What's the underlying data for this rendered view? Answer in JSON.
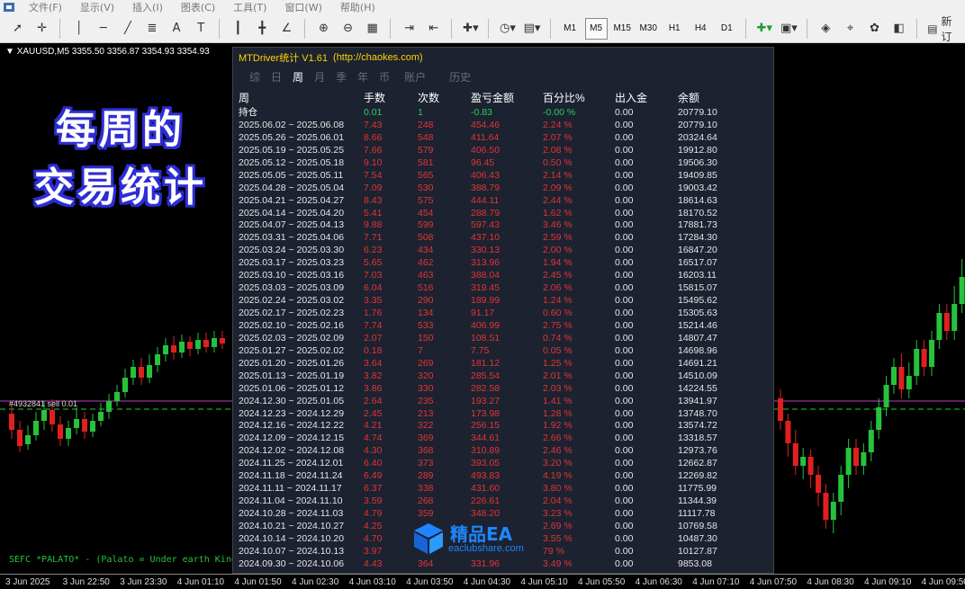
{
  "menu": [
    "文件(F)",
    "显示(V)",
    "插入(I)",
    "图表(C)",
    "工具(T)",
    "窗口(W)",
    "帮助(H)"
  ],
  "toolbar": {
    "timeframes": [
      "M1",
      "M5",
      "M15",
      "M30",
      "H1",
      "H4",
      "D1"
    ],
    "active_timeframe": "M5",
    "new_order_label": "新订"
  },
  "chart": {
    "symbol_line": "XAUUSD,M5  3355.50 3356.87 3354.93 3354.93",
    "order_label": "#4932841   sell 0.01",
    "ticker": "SEFC *PALATO* - (Palato = Under earth King",
    "x_labels": [
      "3 Jun 2025",
      "3 Jun 22:50",
      "3 Jun 23:30",
      "4 Jun 01:10",
      "4 Jun 01:50",
      "4 Jun 02:30",
      "4 Jun 03:10",
      "4 Jun 03:50",
      "4 Jun 04:30",
      "4 Jun 05:10",
      "4 Jun 05:50",
      "4 Jun 06:30",
      "4 Jun 07:10",
      "4 Jun 07:50",
      "4 Jun 08:30",
      "4 Jun 09:10",
      "4 Jun 09:50"
    ]
  },
  "overlay": {
    "line1": "每周的",
    "line2": "交易统计"
  },
  "panel": {
    "title": "MTDriver统计 V1.61",
    "url": "(http://chaokes.com)",
    "tabs": [
      "综",
      "日",
      "周",
      "月",
      "季",
      "年",
      "币",
      "账户",
      "历史"
    ],
    "active_tab": "周",
    "headers": [
      "周",
      "手数",
      "次数",
      "盈亏金额",
      "百分比%",
      "出入金",
      "余额"
    ],
    "holding": [
      "持仓",
      "0.01",
      "1",
      "-0.83",
      "-0.00 %",
      "0.00",
      "20779.10"
    ],
    "rows": [
      [
        "2025.06.02 ~ 2025.06.08",
        "7.43",
        "248",
        "454.46",
        "2.24 %",
        "0.00",
        "20779.10"
      ],
      [
        "2025.05.26 ~ 2025.06.01",
        "8.66",
        "548",
        "411.64",
        "2.07 %",
        "0.00",
        "20324.64"
      ],
      [
        "2025.05.19 ~ 2025.05.25",
        "7.66",
        "579",
        "406.50",
        "2.08 %",
        "0.00",
        "19912.80"
      ],
      [
        "2025.05.12 ~ 2025.05.18",
        "9.10",
        "581",
        "96.45",
        "0.50 %",
        "0.00",
        "19506.30"
      ],
      [
        "2025.05.05 ~ 2025.05.11",
        "7.54",
        "565",
        "406.43",
        "2.14 %",
        "0.00",
        "19409.85"
      ],
      [
        "2025.04.28 ~ 2025.05.04",
        "7.09",
        "530",
        "388.79",
        "2.09 %",
        "0.00",
        "19003.42"
      ],
      [
        "2025.04.21 ~ 2025.04.27",
        "8.43",
        "575",
        "444.11",
        "2.44 %",
        "0.00",
        "18614.63"
      ],
      [
        "2025.04.14 ~ 2025.04.20",
        "5.41",
        "454",
        "288.79",
        "1.62 %",
        "0.00",
        "18170.52"
      ],
      [
        "2025.04.07 ~ 2025.04.13",
        "9.88",
        "599",
        "597.43",
        "3.46 %",
        "0.00",
        "17881.73"
      ],
      [
        "2025.03.31 ~ 2025.04.06",
        "7.71",
        "508",
        "437.10",
        "2.59 %",
        "0.00",
        "17284.30"
      ],
      [
        "2025.03.24 ~ 2025.03.30",
        "6.23",
        "434",
        "330.13",
        "2.00 %",
        "0.00",
        "16847.20"
      ],
      [
        "2025.03.17 ~ 2025.03.23",
        "5.65",
        "462",
        "313.96",
        "1.94 %",
        "0.00",
        "16517.07"
      ],
      [
        "2025.03.10 ~ 2025.03.16",
        "7.03",
        "463",
        "388.04",
        "2.45 %",
        "0.00",
        "16203.11"
      ],
      [
        "2025.03.03 ~ 2025.03.09",
        "6.04",
        "516",
        "319.45",
        "2.06 %",
        "0.00",
        "15815.07"
      ],
      [
        "2025.02.24 ~ 2025.03.02",
        "3.35",
        "290",
        "189.99",
        "1.24 %",
        "0.00",
        "15495.62"
      ],
      [
        "2025.02.17 ~ 2025.02.23",
        "1.76",
        "134",
        "91.17",
        "0.60 %",
        "0.00",
        "15305.63"
      ],
      [
        "2025.02.10 ~ 2025.02.16",
        "7.74",
        "533",
        "406.99",
        "2.75 %",
        "0.00",
        "15214.46"
      ],
      [
        "2025.02.03 ~ 2025.02.09",
        "2.07",
        "150",
        "108.51",
        "0.74 %",
        "0.00",
        "14807.47"
      ],
      [
        "2025.01.27 ~ 2025.02.02",
        "0.18",
        "7",
        "7.75",
        "0.05 %",
        "0.00",
        "14698.96"
      ],
      [
        "2025.01.20 ~ 2025.01.26",
        "3.64",
        "269",
        "181.12",
        "1.25 %",
        "0.00",
        "14691.21"
      ],
      [
        "2025.01.13 ~ 2025.01.19",
        "3.82",
        "320",
        "285.54",
        "2.01 %",
        "0.00",
        "14510.09"
      ],
      [
        "2025.01.06 ~ 2025.01.12",
        "3.86",
        "330",
        "282.58",
        "2.03 %",
        "0.00",
        "14224.55"
      ],
      [
        "2024.12.30 ~ 2025.01.05",
        "2.64",
        "235",
        "193.27",
        "1.41 %",
        "0.00",
        "13941.97"
      ],
      [
        "2024.12.23 ~ 2024.12.29",
        "2.45",
        "213",
        "173.98",
        "1.28 %",
        "0.00",
        "13748.70"
      ],
      [
        "2024.12.16 ~ 2024.12.22",
        "4.21",
        "322",
        "256.15",
        "1.92 %",
        "0.00",
        "13574.72"
      ],
      [
        "2024.12.09 ~ 2024.12.15",
        "4.74",
        "369",
        "344.61",
        "2.66 %",
        "0.00",
        "13318.57"
      ],
      [
        "2024.12.02 ~ 2024.12.08",
        "4.30",
        "368",
        "310.89",
        "2.46 %",
        "0.00",
        "12973.76"
      ],
      [
        "2024.11.25 ~ 2024.12.01",
        "6.40",
        "373",
        "393.05",
        "3.20 %",
        "0.00",
        "12662.87"
      ],
      [
        "2024.11.18 ~ 2024.11.24",
        "6.49",
        "289",
        "493.83",
        "4.19 %",
        "0.00",
        "12269.82"
      ],
      [
        "2024.11.11 ~ 2024.11.17",
        "6.37",
        "338",
        "431.60",
        "3.80 %",
        "0.00",
        "11775.99"
      ],
      [
        "2024.11.04 ~ 2024.11.10",
        "3.59",
        "268",
        "226.61",
        "2.04 %",
        "0.00",
        "11344.39"
      ],
      [
        "2024.10.28 ~ 2024.11.03",
        "4.79",
        "359",
        "348.20",
        "3.23 %",
        "0.00",
        "11117.78"
      ],
      [
        "2024.10.21 ~ 2024.10.27",
        "4.25",
        "",
        "",
        "2.69 %",
        "0.00",
        "10769.58"
      ],
      [
        "2024.10.14 ~ 2024.10.20",
        "4.70",
        "",
        "",
        "3.55 %",
        "0.00",
        "10487.30"
      ],
      [
        "2024.10.07 ~ 2024.10.13",
        "3.97",
        "",
        "",
        "79 %",
        "0.00",
        "10127.87"
      ],
      [
        "2024.09.30 ~ 2024.10.06",
        "4.43",
        "364",
        "331.96",
        "3.49 %",
        "0.00",
        "9853.08"
      ]
    ]
  },
  "watermark": {
    "title": "精品EA",
    "url": "eaclubshare.com"
  },
  "colors": {
    "profit_red": "#e23535",
    "holding_green": "#28d05a",
    "panel_title_yellow": "#ffd400",
    "bull_candle": "#26c23d",
    "bear_candle": "#e02020"
  }
}
